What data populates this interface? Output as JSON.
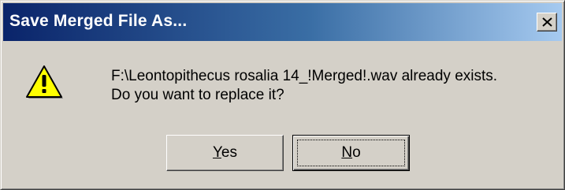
{
  "dialog": {
    "title": "Save Merged File As...",
    "message_line1": "F:\\Leontopithecus rosalia 14_!Merged!.wav already exists.",
    "message_line2": "Do you want to replace it?",
    "icon": "warning-icon",
    "buttons": {
      "yes": {
        "mnemonic": "Y",
        "rest": "es"
      },
      "no": {
        "mnemonic": "N",
        "rest": "o"
      }
    },
    "colors": {
      "face": "#d4d0c8",
      "title_start": "#0a246a",
      "title_end": "#a6caf0",
      "warning_yellow": "#ffff00"
    }
  }
}
